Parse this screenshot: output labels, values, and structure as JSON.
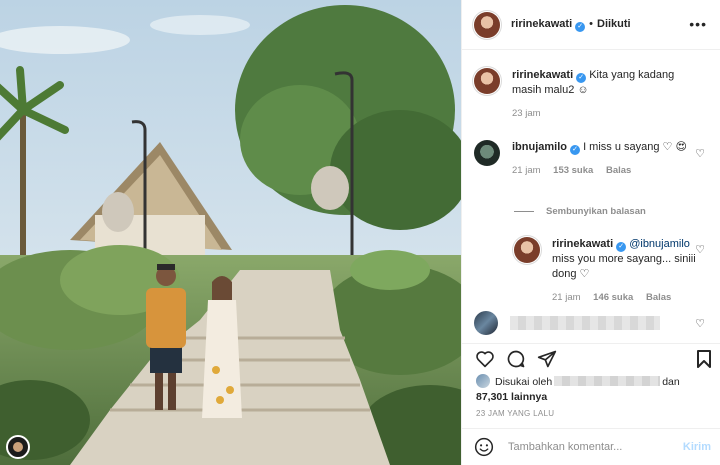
{
  "post": {
    "username": "ririnekawati",
    "follow_status": "Diikuti",
    "separator": "•"
  },
  "comments": [
    {
      "username": "ririnekawati",
      "text": "Kita yang kadang masih malu2 ☺",
      "time": "23 jam"
    },
    {
      "username": "ibnujamilo",
      "text": "I miss u sayang ♡ 😍",
      "time": "21 jam",
      "likes": "153 suka",
      "reply_label": "Balas"
    }
  ],
  "hide_replies_label": "Sembunyikan balasan",
  "reply": {
    "username": "ririnekawati",
    "mention": "@ibnujamilo",
    "text": "miss you more sayang... siniii dong ♡",
    "time": "21 jam",
    "likes": "146 suka",
    "reply_label": "Balas"
  },
  "likes": {
    "prefix": "Disukai oleh",
    "suffix": "dan",
    "count": "87,301 lainnya"
  },
  "timestamp": "23 JAM YANG LALU",
  "add_comment": {
    "placeholder": "Tambahkan komentar...",
    "post_label": "Kirim"
  },
  "icons": {
    "verified": "verified-badge-icon",
    "like": "heart-icon",
    "comment": "comment-bubble-icon",
    "share": "paper-plane-icon",
    "save": "bookmark-icon",
    "emoji": "smiley-icon",
    "more": "ellipsis-icon"
  },
  "colors": {
    "verified": "#3897f0",
    "muted": "#8e8e8e",
    "post_disabled": "#b3dbff",
    "mention": "#00376b"
  }
}
